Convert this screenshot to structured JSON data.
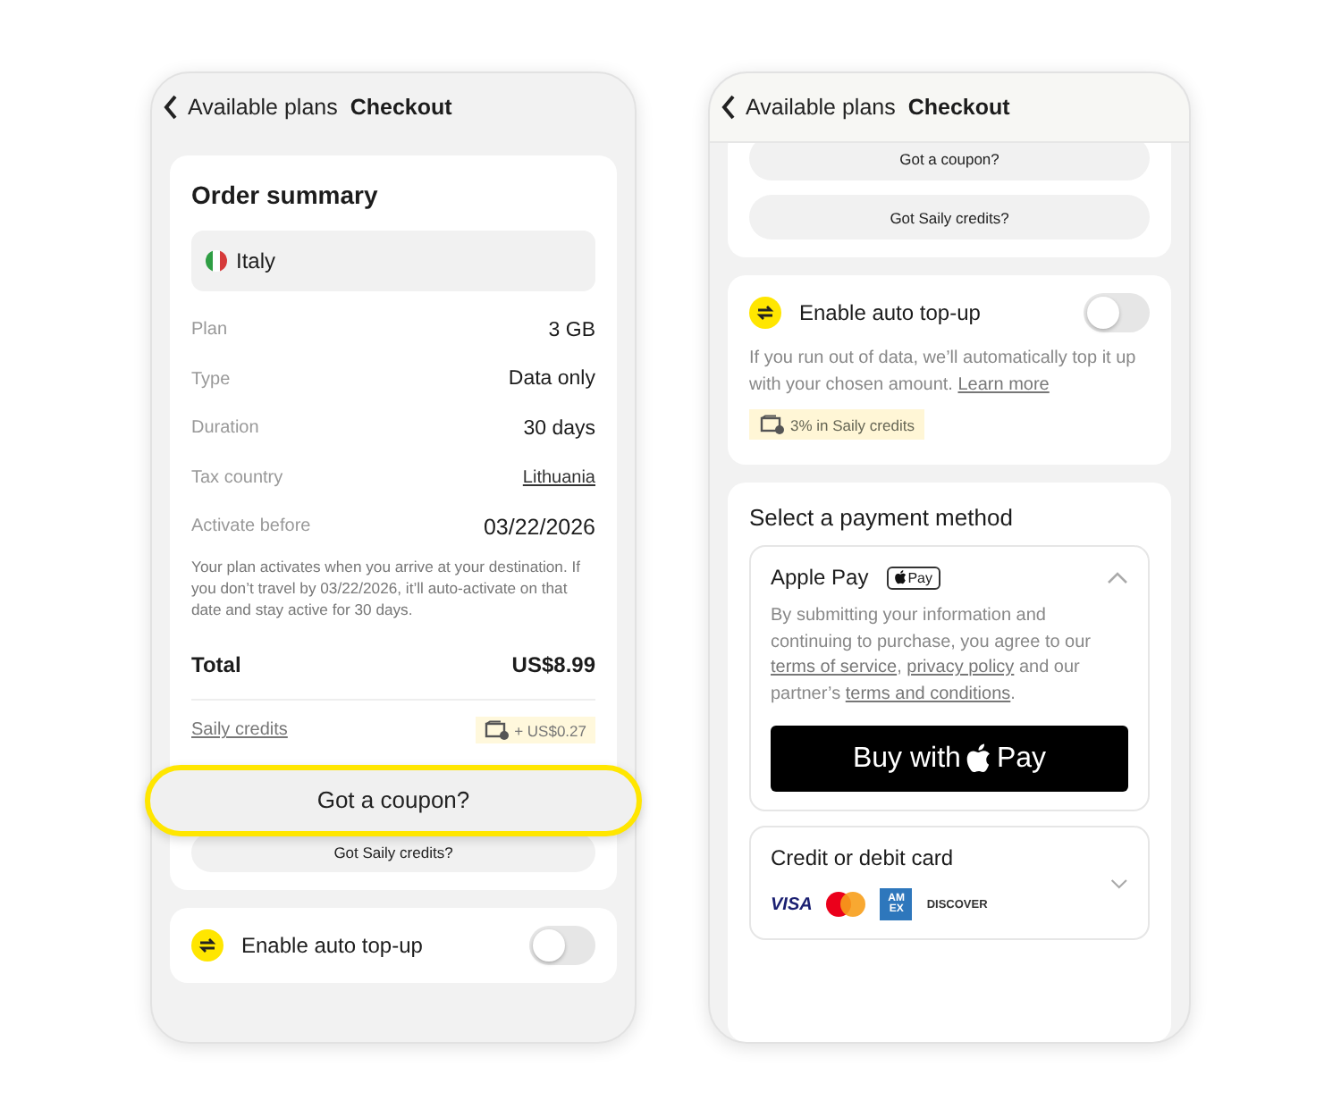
{
  "screens": [
    {
      "header": {
        "back": "Available plans",
        "title": "Checkout"
      },
      "order_summary": {
        "title": "Order summary",
        "country": "Italy",
        "rows": [
          {
            "label": "Plan",
            "value": "3 GB",
            "kind": "text"
          },
          {
            "label": "Type",
            "value": "Data only",
            "kind": "text"
          },
          {
            "label": "Duration",
            "value": "30 days",
            "kind": "text"
          },
          {
            "label": "Tax country",
            "value": "Lithuania",
            "kind": "link"
          },
          {
            "label": "Activate before",
            "value": "03/22/2026",
            "kind": "date"
          }
        ],
        "note": "Your plan activates when you arrive at your destination. If you don’t travel by 03/22/2026, it’ll auto-activate on that date and stay active for 30 days.",
        "total_label": "Total",
        "total_value": "US$8.99",
        "credits_link": "Saily credits",
        "credits_badge": "+ US$0.27"
      },
      "buttons": [
        {
          "label": "Got a coupon?",
          "highlighted": true
        },
        {
          "label": "Got Saily credits?",
          "highlighted": false
        }
      ],
      "auto_topup": {
        "label": "Enable auto top-up",
        "on": false
      }
    },
    {
      "header": {
        "back": "Available plans",
        "title": "Checkout"
      },
      "buttons": [
        {
          "label": "Got a coupon?",
          "highlighted": false
        },
        {
          "label": "Got Saily credits?",
          "highlighted": false
        }
      ],
      "auto_topup": {
        "label": "Enable auto top-up",
        "on": false,
        "description": "If you run out of data, we’ll automatically top it up with your chosen amount.",
        "link": "Learn more",
        "badge": "3% in Saily credits"
      },
      "payment": {
        "title": "Select a payment method",
        "methods": [
          {
            "kind": "apple_pay",
            "name": "Apple Pay",
            "badge": "Pay",
            "expanded": true,
            "terms": [
              {
                "text": "By submitting your information and continuing to purchase, you agree to our ",
                "kind": "text"
              },
              {
                "text": "terms of service",
                "kind": "link"
              },
              {
                "text": ", ",
                "kind": "text"
              },
              {
                "text": "privacy policy",
                "kind": "link"
              },
              {
                "text": " and our partner’s ",
                "kind": "text"
              },
              {
                "text": "terms and conditions",
                "kind": "link"
              },
              {
                "text": ".",
                "kind": "text"
              }
            ],
            "button_before": "Buy with",
            "button_after": "Pay"
          },
          {
            "kind": "card",
            "name": "Credit or debit card",
            "expanded": false,
            "brands": [
              {
                "kind": "visa",
                "text": "VISA"
              },
              {
                "kind": "mastercard"
              },
              {
                "kind": "amex",
                "text": "AM EX"
              },
              {
                "kind": "discover",
                "text": "DISCOVER"
              }
            ]
          }
        ]
      }
    }
  ]
}
